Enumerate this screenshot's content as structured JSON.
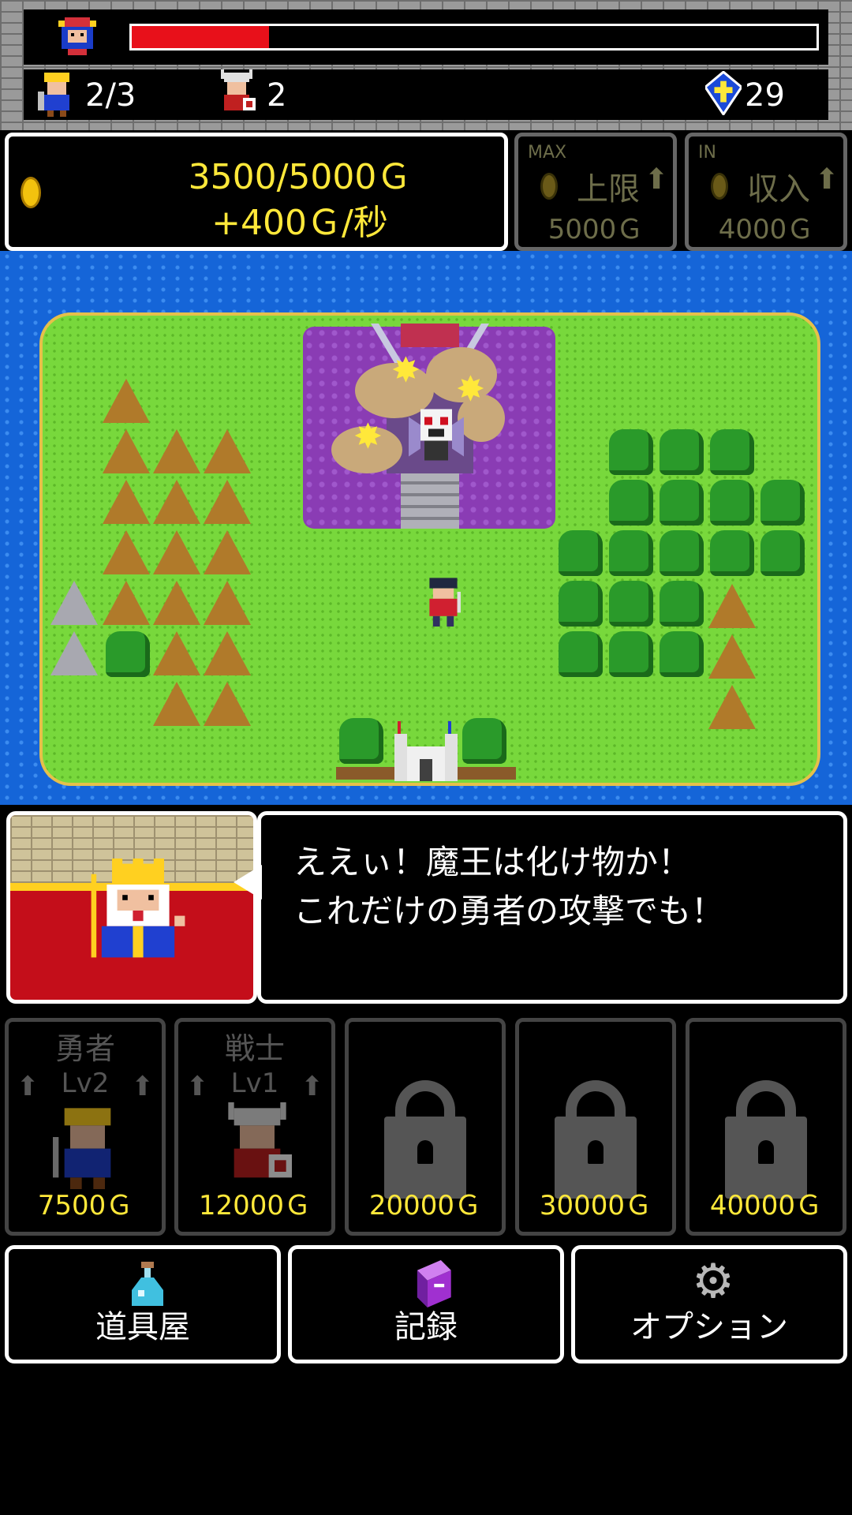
{
  "header": {
    "boss_hp_fraction": 0.2,
    "heroes_count": "2/3",
    "soldiers_count": "2",
    "crystals": "29"
  },
  "gold_panel": {
    "gold": "3500/5000Ｇ",
    "rate": "+400Ｇ/秒"
  },
  "upgrades": [
    {
      "tag": "MAX",
      "label": "上限",
      "arrow": "⬆",
      "price": "5000Ｇ"
    },
    {
      "tag": "IN",
      "label": "収入",
      "arrow": "⬆",
      "price": "4000Ｇ"
    }
  ],
  "dialog": {
    "text": "ええぃ！魔王は化け物か！\nこれだけの勇者の攻撃でも！"
  },
  "units": [
    {
      "name": "勇者",
      "level": "Lv2",
      "price": "7500Ｇ",
      "locked": false
    },
    {
      "name": "戦士",
      "level": "Lv1",
      "price": "12000Ｇ",
      "locked": false
    },
    {
      "price": "20000Ｇ",
      "locked": true
    },
    {
      "price": "30000Ｇ",
      "locked": true
    },
    {
      "price": "40000Ｇ",
      "locked": true
    }
  ],
  "menu": [
    {
      "label": "道具屋",
      "icon": "potion-icon"
    },
    {
      "label": "記録",
      "icon": "book-icon"
    },
    {
      "label": "オプション",
      "icon": "gear-icon"
    }
  ],
  "colors": {
    "hp": "#e8101a",
    "gold": "#ffe83a",
    "sea": "#1565d8",
    "grass": "#78d83c"
  }
}
